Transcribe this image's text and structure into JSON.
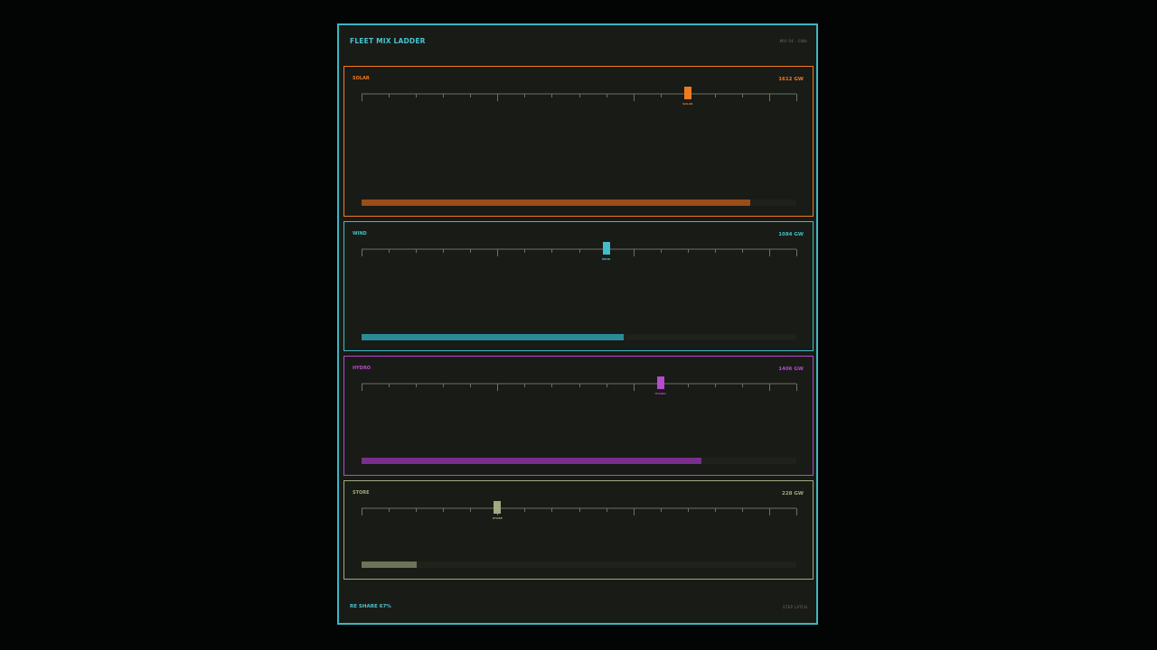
{
  "header": {
    "title": "FLEET MIX LADDER",
    "meta": "MIX 04 · GWe"
  },
  "footer": {
    "re_share": "RE SHARE 67%",
    "right_label": "STEP LATCH"
  },
  "panels": [
    {
      "id": "solar",
      "label": "SOLAR",
      "value_text": "1612 GW",
      "marker_label": "SOLAR",
      "marker_fraction": 0.75,
      "fill_fraction": 0.895,
      "color": "#ee7a22",
      "fill_color": "#9a4d18"
    },
    {
      "id": "wind",
      "label": "WIND",
      "value_text": "1084 GW",
      "marker_label": "WIND",
      "marker_fraction": 0.5625,
      "fill_fraction": 0.602,
      "color": "#43bdc9",
      "fill_color": "#2a8c96"
    },
    {
      "id": "hydro",
      "label": "HYDRO",
      "value_text": "1406 GW",
      "marker_label": "HYDRO",
      "marker_fraction": 0.6875,
      "fill_fraction": 0.781,
      "color": "#b64ad0",
      "fill_color": "#7a2e8e"
    },
    {
      "id": "store",
      "label": "STORE",
      "value_text": "228 GW",
      "marker_label": "STORE",
      "marker_fraction": 0.3125,
      "fill_fraction": 0.127,
      "color": "#a3a881",
      "fill_color": "#6d7356"
    }
  ]
}
